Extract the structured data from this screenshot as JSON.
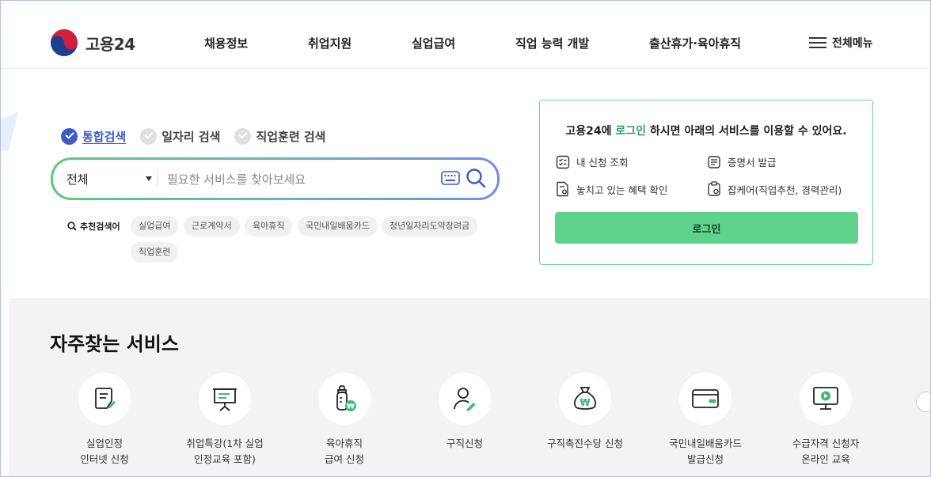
{
  "header": {
    "logo_text": "고용24",
    "nav": [
      "채용정보",
      "취업지원",
      "실업급여",
      "직업 능력 개발",
      "출산휴가·육아휴직"
    ],
    "menu_label": "전체메뉴"
  },
  "search": {
    "tabs": [
      {
        "label": "통합검색",
        "active": true
      },
      {
        "label": "일자리 검색",
        "active": false
      },
      {
        "label": "직업훈련 검색",
        "active": false
      }
    ],
    "category": "전체",
    "placeholder": "필요한 서비스를 찾아보세요",
    "recommend_label": "추천검색어",
    "keywords": [
      "실업급여",
      "근로계약서",
      "육아휴직",
      "국민내일배움카드",
      "청년일자리도약장려금",
      "직업훈련"
    ]
  },
  "login_card": {
    "title_prefix": "고용24에 ",
    "title_highlight": "로그인",
    "title_suffix": " 하시면 아래의 서비스를 이용할 수 있어요.",
    "services": [
      "내 신청 조회",
      "증명서 발급",
      "놓치고 있는 혜택 확인",
      "잡케어(직업추천, 경력관리)"
    ],
    "button_label": "로그인"
  },
  "frequent": {
    "title": "자주찾는 서비스",
    "items": [
      {
        "label": "실업인정\n인터넷 신청",
        "icon": "document-pen-icon"
      },
      {
        "label": "취업특강(1차 실업\n인정교육 포함)",
        "icon": "presentation-board-icon"
      },
      {
        "label": "육아휴직\n급여 신청",
        "icon": "baby-bottle-won-icon"
      },
      {
        "label": "구직신청",
        "icon": "person-pen-icon"
      },
      {
        "label": "구직촉진수당 신청",
        "icon": "money-bag-won-icon"
      },
      {
        "label": "국민내일배움카드\n발급신청",
        "icon": "card-icon"
      },
      {
        "label": "수급자격 신청자\n온라인 교육",
        "icon": "monitor-play-icon"
      }
    ]
  },
  "colors": {
    "accent_blue": "#3d5bc8",
    "accent_green": "#5fd38e",
    "brand_green_text": "#2f9e57"
  }
}
